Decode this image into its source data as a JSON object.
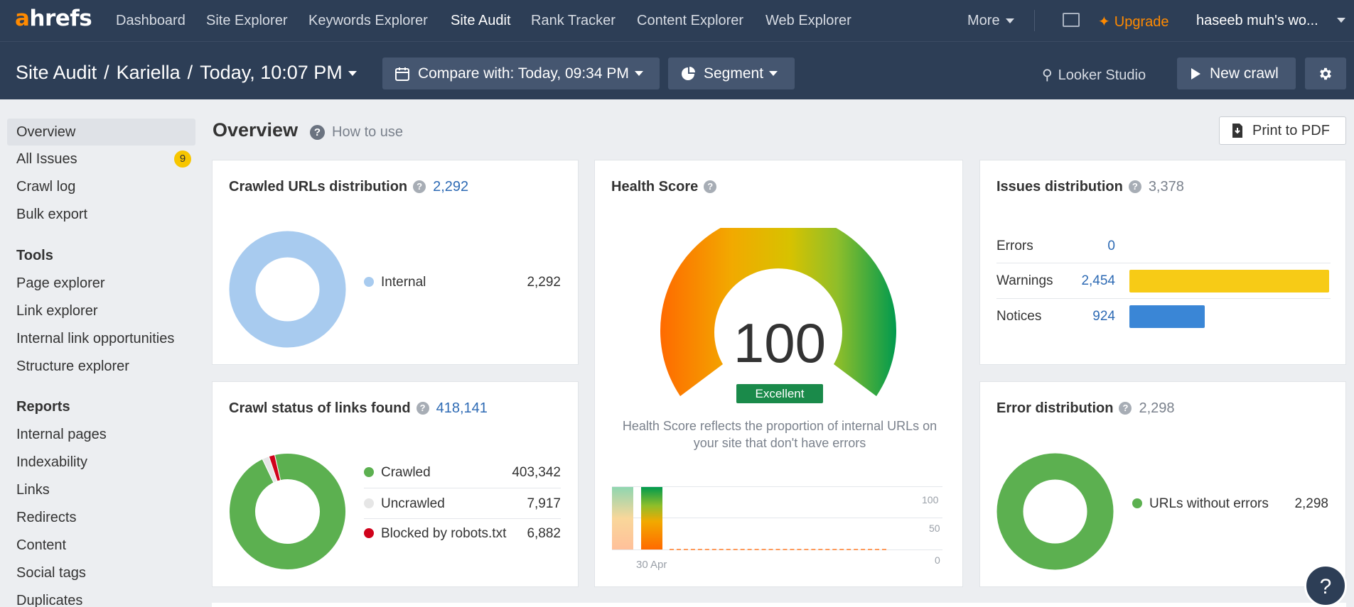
{
  "brand": {
    "logo_a": "a",
    "logo_rest": "hrefs",
    "accent": "#ff8a00",
    "nav_bg": "#2d3e56"
  },
  "topnav": {
    "items": [
      "Dashboard",
      "Site Explorer",
      "Keywords Explorer",
      "Site Audit",
      "Rank Tracker",
      "Content Explorer",
      "Web Explorer"
    ],
    "active": "Site Audit",
    "more_label": "More",
    "upgrade_label": "Upgrade",
    "account_label": "haseeb muh's wo..."
  },
  "subheader": {
    "crumb_1": "Site Audit",
    "crumb_2": "Kariella",
    "crumb_3": "Today, 10:07 PM",
    "compare_label": "Compare with: Today, 09:34 PM",
    "segment_label": "Segment",
    "looker_label": "Looker Studio",
    "new_crawl_label": "New crawl"
  },
  "sidebar": {
    "items": [
      "Overview",
      "All Issues",
      "Crawl log",
      "Bulk export"
    ],
    "all_issues_badge": "9",
    "tools_heading": "Tools",
    "tools": [
      "Page explorer",
      "Link explorer",
      "Internal link opportunities",
      "Structure explorer"
    ],
    "reports_heading": "Reports",
    "reports": [
      "Internal pages",
      "Indexability",
      "Links",
      "Redirects",
      "Content",
      "Social tags",
      "Duplicates"
    ]
  },
  "main": {
    "title": "Overview",
    "how_to_use": "How to use",
    "print_label": "Print to PDF"
  },
  "crawled_urls": {
    "title": "Crawled URLs distribution",
    "count": "2,292",
    "legend": [
      {
        "label": "Internal",
        "value": "2,292",
        "color": "#a8cbef"
      }
    ]
  },
  "crawl_status": {
    "title": "Crawl status of links found",
    "count": "418,141",
    "legend": [
      {
        "label": "Crawled",
        "value": "403,342",
        "color": "#5cb050"
      },
      {
        "label": "Uncrawled",
        "value": "7,917",
        "color": "#e6e6e6"
      },
      {
        "label": "Blocked by robots.txt",
        "value": "6,882",
        "color": "#d0021b"
      }
    ]
  },
  "health_score": {
    "title": "Health Score",
    "score": "100",
    "rating": "Excellent",
    "description": "Health Score reflects the proportion of internal URLs on your site that don't have errors",
    "history_axis": [
      "100",
      "50",
      "0"
    ],
    "history_date": "30 Apr"
  },
  "issues_distribution": {
    "title": "Issues distribution",
    "count": "3,378",
    "rows": [
      {
        "label": "Errors",
        "value": "0",
        "color": "#e23b2e"
      },
      {
        "label": "Warnings",
        "value": "2,454",
        "color": "#f7cb16"
      },
      {
        "label": "Notices",
        "value": "924",
        "color": "#3a86d6"
      }
    ]
  },
  "error_distribution": {
    "title": "Error distribution",
    "count": "2,298",
    "legend": [
      {
        "label": "URLs without errors",
        "value": "2,298",
        "color": "#5cb050"
      }
    ]
  },
  "help_label": "?",
  "chart_data": [
    {
      "type": "pie",
      "title": "Crawled URLs distribution",
      "labels": [
        "Internal"
      ],
      "values": [
        2292
      ]
    },
    {
      "type": "pie",
      "title": "Crawl status of links found",
      "labels": [
        "Crawled",
        "Uncrawled",
        "Blocked by robots.txt"
      ],
      "values": [
        403342,
        7917,
        6882
      ]
    },
    {
      "type": "bar",
      "title": "Issues distribution",
      "categories": [
        "Errors",
        "Warnings",
        "Notices"
      ],
      "values": [
        0,
        2454,
        924
      ]
    },
    {
      "type": "pie",
      "title": "Error distribution",
      "labels": [
        "URLs without errors"
      ],
      "values": [
        2298
      ]
    }
  ]
}
